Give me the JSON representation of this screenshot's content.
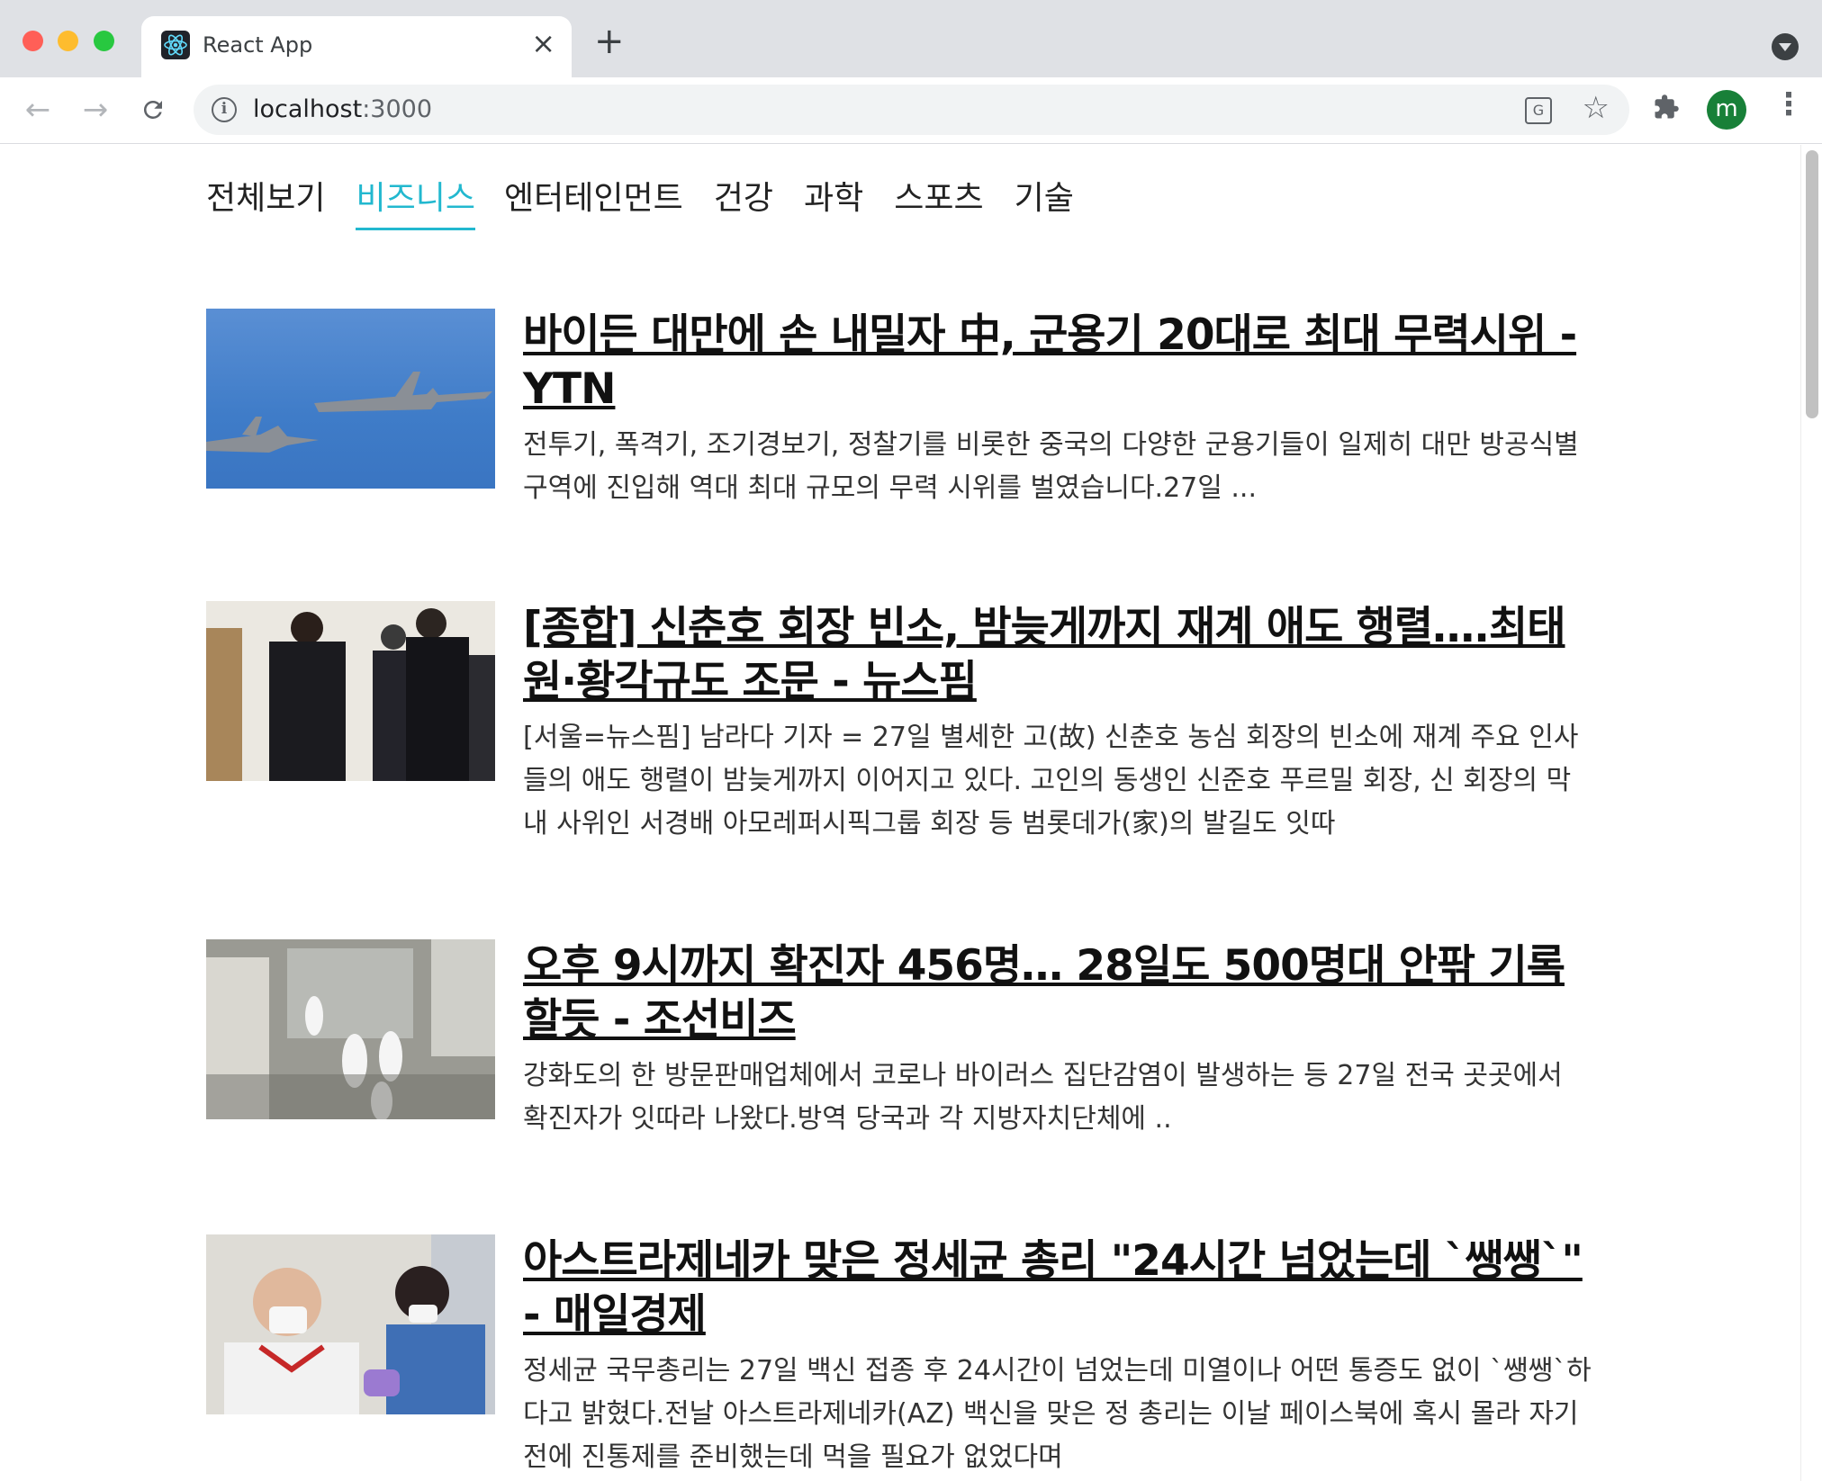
{
  "browser": {
    "tab_title": "React App",
    "url_host": "localhost",
    "url_port": ":3000",
    "profile_initial": "m"
  },
  "categories": [
    {
      "label": "전체보기",
      "active": false
    },
    {
      "label": "비즈니스",
      "active": true
    },
    {
      "label": "엔터테인먼트",
      "active": false
    },
    {
      "label": "건강",
      "active": false
    },
    {
      "label": "과학",
      "active": false
    },
    {
      "label": "스포츠",
      "active": false
    },
    {
      "label": "기술",
      "active": false
    }
  ],
  "articles": [
    {
      "title": "바이든 대만에 손 내밀자 中, 군용기 20대로 최대 무력시위 - YTN",
      "description": "전투기, 폭격기, 조기경보기, 정찰기를 비롯한 중국의 다양한 군용기들이 일제히 대만 방공식별 구역에 진입해 역대 최대 규모의 무력 시위를 벌였습니다.27일 ..."
    },
    {
      "title": "[종합] 신춘호 회장 빈소, 밤늦게까지 재계 애도 행렬….최태원·황각규도 조문 - 뉴스핌",
      "description": "[서울=뉴스핌] 남라다 기자 = 27일 별세한 고(故) 신춘호 농심 회장의 빈소에 재계 주요 인사들의 애도 행렬이 밤늦게까지 이어지고 있다. 고인의 동생인 신준호 푸르밀 회장, 신 회장의 막내 사위인 서경배 아모레퍼시픽그룹 회장 등 범롯데가(家)의 발길도 잇따"
    },
    {
      "title": "오후 9시까지 확진자 456명… 28일도 500명대 안팎 기록할듯 - 조선비즈",
      "description": "강화도의 한 방문판매업체에서 코로나 바이러스 집단감염이 발생하는 등 27일 전국 곳곳에서 확진자가 잇따라 나왔다.방역 당국과 각 지방자치단체에 .."
    },
    {
      "title": "아스트라제네카 맞은 정세균 총리 \"24시간 넘었는데 `쌩쌩`\" - 매일경제",
      "description": "정세균 국무총리는 27일 백신 접종 후 24시간이 넘었는데 미열이나 어떤 통증도 없이 `쌩쌩`하다고 밝혔다.전날 아스트라제네카(AZ) 백신을 맞은 정 총리는 이날 페이스북에 혹시 몰라 자기 전에 진통제를 준비했는데 먹을 필요가 없었다며"
    }
  ],
  "colors": {
    "accent": "#22b8cf",
    "title_text": "#111111",
    "body_text": "#333333"
  }
}
